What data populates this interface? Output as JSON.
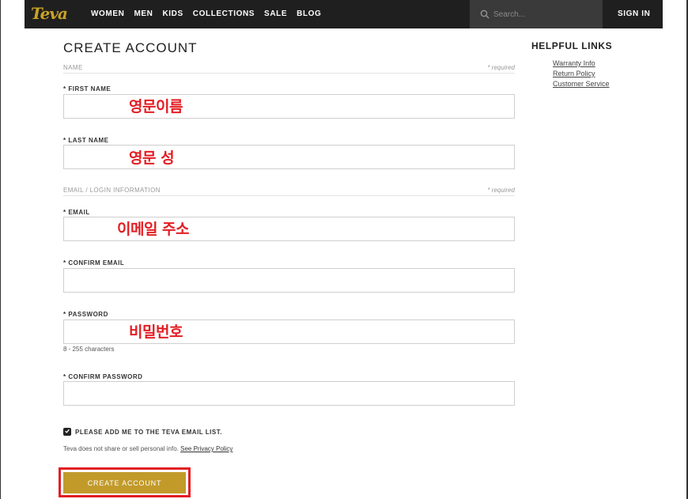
{
  "nav": {
    "logo": "Teva",
    "links": [
      "WOMEN",
      "MEN",
      "KIDS",
      "COLLECTIONS",
      "SALE",
      "BLOG"
    ],
    "search_placeholder": "Search...",
    "signin": "SIGN IN",
    "logo_color": "#c9a227",
    "bg_color": "#1f1f1f"
  },
  "form": {
    "title": "CREATE ACCOUNT",
    "section_name": {
      "label": "NAME",
      "required": "* required"
    },
    "first_name": {
      "label": "* FIRST NAME",
      "annotation": "영문이름",
      "value": ""
    },
    "last_name": {
      "label": "* LAST NAME",
      "annotation": "영문 성",
      "value": ""
    },
    "section_email": {
      "label": "EMAIL / LOGIN INFORMATION",
      "required": "* required"
    },
    "email": {
      "label": "* EMAIL",
      "annotation": "이메일 주소",
      "value": ""
    },
    "confirm_email": {
      "label": "* CONFIRM EMAIL",
      "value": ""
    },
    "password": {
      "label": "* PASSWORD",
      "annotation": "비밀번호",
      "hint": "8 - 255 characters",
      "value": ""
    },
    "confirm_password": {
      "label": "* CONFIRM PASSWORD",
      "value": ""
    },
    "newsletter": {
      "label": "PLEASE ADD ME TO THE TEVA EMAIL LIST.",
      "checked": true
    },
    "privacy": {
      "text": "Teva does not share or sell personal info.",
      "link": "See Privacy Policy"
    },
    "submit_label": "CREATE ACCOUNT",
    "button_color": "#c19a2a",
    "annotation_color": "#e31e24"
  },
  "helpful": {
    "title": "HELPFUL LINKS",
    "links": [
      "Warranty Info",
      "Return Policy",
      "Customer Service"
    ]
  }
}
